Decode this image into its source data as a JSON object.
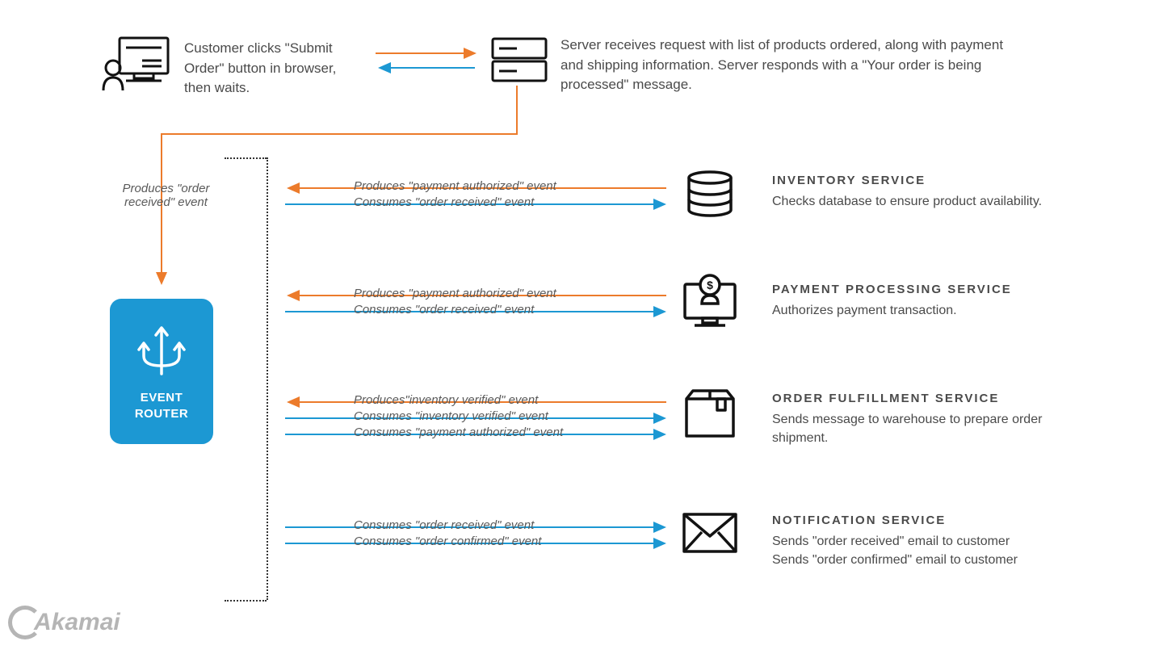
{
  "colors": {
    "orange": "#ec7b2b",
    "blue": "#1c98d3",
    "stroke": "#121212"
  },
  "top": {
    "customer_text": "Customer clicks \"Submit Order\" button in browser, then waits.",
    "server_text": "Server receives request with list of products ordered, along with payment and shipping information. Server responds with a \"Your order is being processed\" message."
  },
  "produces_label": "Produces \"order received\" event",
  "event_router": {
    "line1": "EVENT",
    "line2": "ROUTER"
  },
  "services": [
    {
      "title": "INVENTORY SERVICE",
      "desc": "Checks database to ensure product availability.",
      "arrows": [
        {
          "type": "produces",
          "label": "Produces \"payment authorized\" event"
        },
        {
          "type": "consumes",
          "label": "Consumes \"order received\" event"
        }
      ]
    },
    {
      "title": "PAYMENT PROCESSING SERVICE",
      "desc": "Authorizes payment transaction.",
      "arrows": [
        {
          "type": "produces",
          "label": "Produces \"payment authorized\" event"
        },
        {
          "type": "consumes",
          "label": "Consumes \"order received\" event"
        }
      ]
    },
    {
      "title": "ORDER FULFILLMENT SERVICE",
      "desc": "Sends message to warehouse to prepare order shipment.",
      "arrows": [
        {
          "type": "produces",
          "label": "Produces\"inventory verified\" event"
        },
        {
          "type": "consumes",
          "label": "Consumes \"inventory verified\" event"
        },
        {
          "type": "consumes",
          "label": "Consumes \"payment authorized\" event"
        }
      ]
    },
    {
      "title": "NOTIFICATION SERVICE",
      "desc": "Sends \"order received\" email to customer\nSends \"order confirmed\" email to customer",
      "arrows": [
        {
          "type": "consumes",
          "label": "Consumes \"order received\" event"
        },
        {
          "type": "consumes",
          "label": "Consumes \"order confirmed\" event"
        }
      ]
    }
  ],
  "brand": "Akamai"
}
